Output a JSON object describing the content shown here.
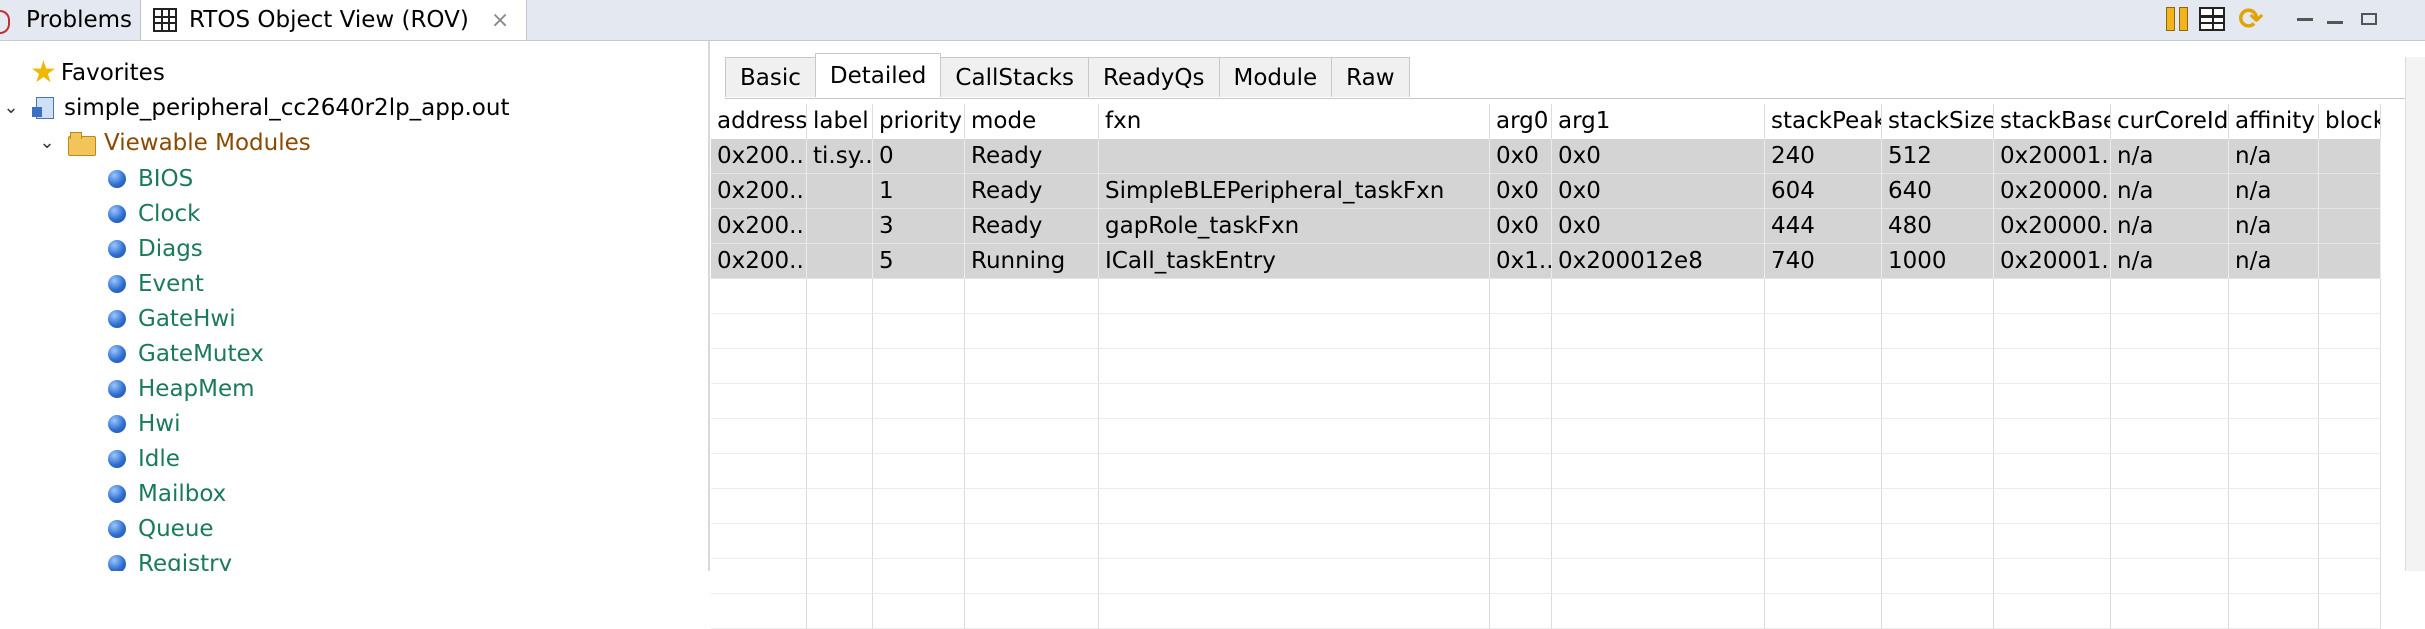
{
  "tabs": {
    "problems_label": "Problems",
    "rov_label": "RTOS Object View (ROV)",
    "close_glyph": "⨯"
  },
  "tree": {
    "favorites": "Favorites",
    "project": "simple_peripheral_cc2640r2lp_app.out",
    "folder": "Viewable Modules",
    "modules": [
      "BIOS",
      "Clock",
      "Diags",
      "Event",
      "GateHwi",
      "GateMutex",
      "HeapMem",
      "Hwi",
      "Idle",
      "Mailbox",
      "Queue",
      "Registry"
    ]
  },
  "view_tabs": [
    "Basic",
    "Detailed",
    "CallStacks",
    "ReadyQs",
    "Module",
    "Raw"
  ],
  "active_view_tab": "Detailed",
  "table": {
    "columns": [
      "address",
      "label",
      "priority",
      "mode",
      "fxn",
      "arg0",
      "arg1",
      "stackPeak",
      "stackSize",
      "stackBase",
      "curCoreId",
      "affinity",
      "block"
    ],
    "rows": [
      [
        "0x200...",
        "ti.sy...",
        "0",
        "Ready",
        "",
        "0x0",
        "0x0",
        "240",
        "512",
        "0x20001...",
        "n/a",
        "n/a",
        ""
      ],
      [
        "0x200...",
        "",
        "1",
        "Ready",
        "SimpleBLEPeripheral_taskFxn",
        "0x0",
        "0x0",
        "604",
        "640",
        "0x20000...",
        "n/a",
        "n/a",
        ""
      ],
      [
        "0x200...",
        "",
        "3",
        "Ready",
        "gapRole_taskFxn",
        "0x0",
        "0x0",
        "444",
        "480",
        "0x20000...",
        "n/a",
        "n/a",
        ""
      ],
      [
        "0x200...",
        "",
        "5",
        "Running",
        "ICall_taskEntry",
        "0x1...",
        "0x200012e8",
        "740",
        "1000",
        "0x20001...",
        "n/a",
        "n/a",
        ""
      ]
    ],
    "empty_rows": 10
  },
  "colors": {
    "module_text": "#1a7a5a",
    "folder_text": "#8a4a00",
    "row_fill": "#d4d4d4"
  }
}
